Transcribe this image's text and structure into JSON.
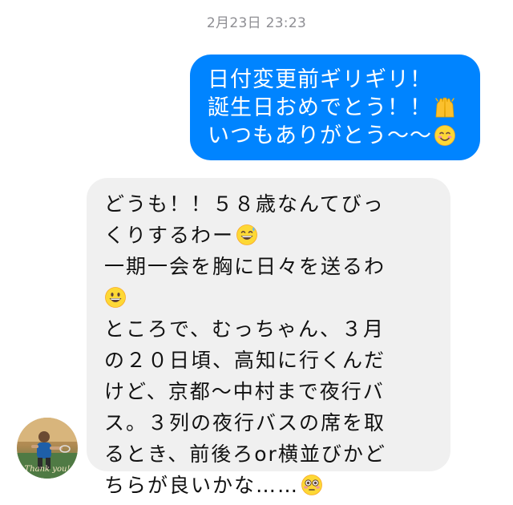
{
  "conversation": {
    "timestamp": "2月23日 23:23",
    "sent_message": {
      "lines": [
        "日付変更前ギリギリ！",
        "誕生日おめでとう！！",
        "いつもありがとう〜〜"
      ],
      "emojis": [
        "raised-hands-icon",
        "smiling-face-icon"
      ]
    },
    "received_message": {
      "lines": [
        "どうも！！５８歳なんてびっ",
        "くりするわー",
        "一期一会を胸に日々を送るわ",
        "",
        "ところで、むっちゃん、３月",
        "の２０日頃、高知に行くんだ",
        "けど、京都〜中村まで夜行バ",
        "ス。３列の夜行バスの席を取",
        "るとき、前後ろor横並びかど",
        "ちらが良いかな……"
      ],
      "emojis": [
        "grinning-sweat-icon",
        "grinning-face-icon",
        "flushed-face-icon"
      ]
    },
    "avatar": {
      "label": "Thank you!"
    }
  },
  "colors": {
    "sent_bubble": "#0084ff",
    "received_bubble": "#f0f0f0",
    "timestamp": "#8e8e93"
  }
}
